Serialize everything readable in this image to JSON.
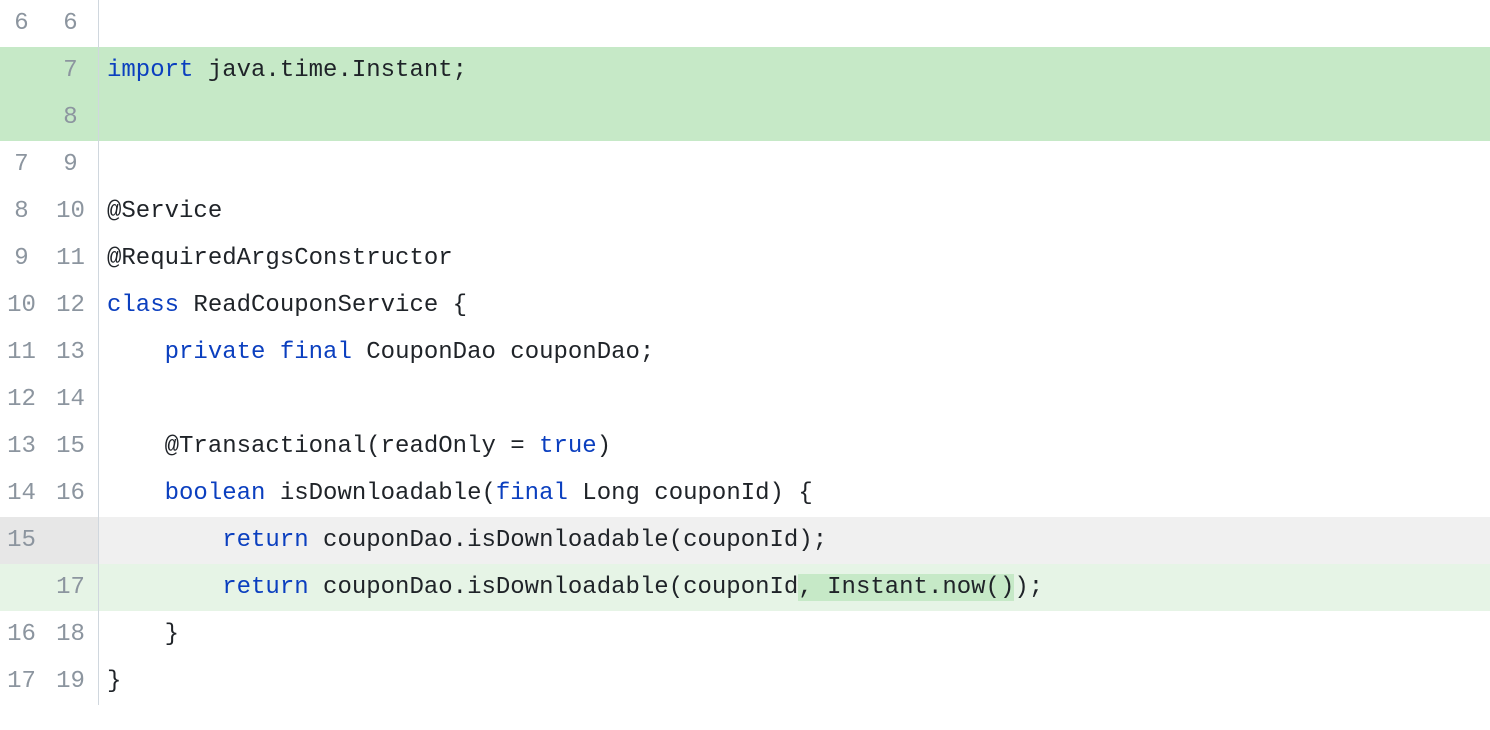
{
  "lines": {
    "l0": {
      "old": "6",
      "new": "6",
      "code": ""
    },
    "l1": {
      "old": "",
      "new": "7"
    },
    "l1_tokens": {
      "t0": "import",
      "t1": " java.time.Instant;"
    },
    "l2": {
      "old": "",
      "new": "8",
      "code": ""
    },
    "l3": {
      "old": "7",
      "new": "9",
      "code": ""
    },
    "l4": {
      "old": "8",
      "new": "10",
      "code": "@Service"
    },
    "l5": {
      "old": "9",
      "new": "11",
      "code": "@RequiredArgsConstructor"
    },
    "l6": {
      "old": "10",
      "new": "12"
    },
    "l6_tokens": {
      "t0": "class",
      "t1": " ReadCouponService {"
    },
    "l7": {
      "old": "11",
      "new": "13"
    },
    "l7_tokens": {
      "t0": "    ",
      "t1": "private",
      "t2": " ",
      "t3": "final",
      "t4": " CouponDao couponDao;"
    },
    "l8": {
      "old": "12",
      "new": "14",
      "code": ""
    },
    "l9": {
      "old": "13",
      "new": "15"
    },
    "l9_tokens": {
      "t0": "    @Transactional(readOnly = ",
      "t1": "true",
      "t2": ")"
    },
    "l10": {
      "old": "14",
      "new": "16"
    },
    "l10_tokens": {
      "t0": "    ",
      "t1": "boolean",
      "t2": " isDownloadable(",
      "t3": "final",
      "t4": " Long couponId) {"
    },
    "l11": {
      "old": "15",
      "new": ""
    },
    "l11_tokens": {
      "t0": "        ",
      "t1": "return",
      "t2": " couponDao.isDownloadable(couponId);"
    },
    "l12": {
      "old": "",
      "new": "17"
    },
    "l12_tokens": {
      "t0": "        ",
      "t1": "return",
      "t2": " couponDao.isDownloadable(couponId",
      "t3": ", Instant.now()",
      "t4": ");"
    },
    "l13": {
      "old": "16",
      "new": "18",
      "code": "    }"
    },
    "l14": {
      "old": "17",
      "new": "19",
      "code": "}"
    }
  }
}
